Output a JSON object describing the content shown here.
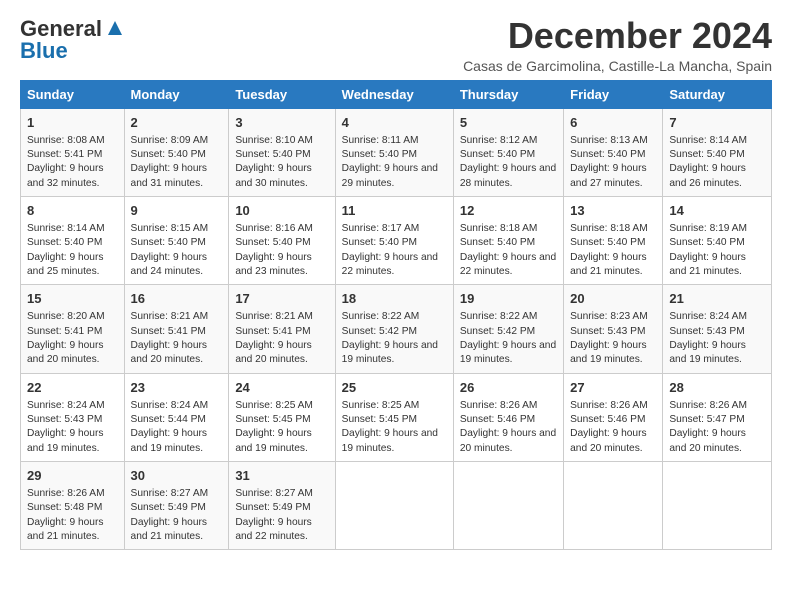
{
  "logo": {
    "line1": "General",
    "line2": "Blue"
  },
  "title": "December 2024",
  "subtitle": "Casas de Garcimolina, Castille-La Mancha, Spain",
  "days_of_week": [
    "Sunday",
    "Monday",
    "Tuesday",
    "Wednesday",
    "Thursday",
    "Friday",
    "Saturday"
  ],
  "weeks": [
    [
      {
        "day": "1",
        "sunrise": "8:08 AM",
        "sunset": "5:41 PM",
        "daylight": "9 hours and 32 minutes."
      },
      {
        "day": "2",
        "sunrise": "8:09 AM",
        "sunset": "5:40 PM",
        "daylight": "9 hours and 31 minutes."
      },
      {
        "day": "3",
        "sunrise": "8:10 AM",
        "sunset": "5:40 PM",
        "daylight": "9 hours and 30 minutes."
      },
      {
        "day": "4",
        "sunrise": "8:11 AM",
        "sunset": "5:40 PM",
        "daylight": "9 hours and 29 minutes."
      },
      {
        "day": "5",
        "sunrise": "8:12 AM",
        "sunset": "5:40 PM",
        "daylight": "9 hours and 28 minutes."
      },
      {
        "day": "6",
        "sunrise": "8:13 AM",
        "sunset": "5:40 PM",
        "daylight": "9 hours and 27 minutes."
      },
      {
        "day": "7",
        "sunrise": "8:14 AM",
        "sunset": "5:40 PM",
        "daylight": "9 hours and 26 minutes."
      }
    ],
    [
      {
        "day": "8",
        "sunrise": "8:14 AM",
        "sunset": "5:40 PM",
        "daylight": "9 hours and 25 minutes."
      },
      {
        "day": "9",
        "sunrise": "8:15 AM",
        "sunset": "5:40 PM",
        "daylight": "9 hours and 24 minutes."
      },
      {
        "day": "10",
        "sunrise": "8:16 AM",
        "sunset": "5:40 PM",
        "daylight": "9 hours and 23 minutes."
      },
      {
        "day": "11",
        "sunrise": "8:17 AM",
        "sunset": "5:40 PM",
        "daylight": "9 hours and 22 minutes."
      },
      {
        "day": "12",
        "sunrise": "8:18 AM",
        "sunset": "5:40 PM",
        "daylight": "9 hours and 22 minutes."
      },
      {
        "day": "13",
        "sunrise": "8:18 AM",
        "sunset": "5:40 PM",
        "daylight": "9 hours and 21 minutes."
      },
      {
        "day": "14",
        "sunrise": "8:19 AM",
        "sunset": "5:40 PM",
        "daylight": "9 hours and 21 minutes."
      }
    ],
    [
      {
        "day": "15",
        "sunrise": "8:20 AM",
        "sunset": "5:41 PM",
        "daylight": "9 hours and 20 minutes."
      },
      {
        "day": "16",
        "sunrise": "8:21 AM",
        "sunset": "5:41 PM",
        "daylight": "9 hours and 20 minutes."
      },
      {
        "day": "17",
        "sunrise": "8:21 AM",
        "sunset": "5:41 PM",
        "daylight": "9 hours and 20 minutes."
      },
      {
        "day": "18",
        "sunrise": "8:22 AM",
        "sunset": "5:42 PM",
        "daylight": "9 hours and 19 minutes."
      },
      {
        "day": "19",
        "sunrise": "8:22 AM",
        "sunset": "5:42 PM",
        "daylight": "9 hours and 19 minutes."
      },
      {
        "day": "20",
        "sunrise": "8:23 AM",
        "sunset": "5:43 PM",
        "daylight": "9 hours and 19 minutes."
      },
      {
        "day": "21",
        "sunrise": "8:24 AM",
        "sunset": "5:43 PM",
        "daylight": "9 hours and 19 minutes."
      }
    ],
    [
      {
        "day": "22",
        "sunrise": "8:24 AM",
        "sunset": "5:43 PM",
        "daylight": "9 hours and 19 minutes."
      },
      {
        "day": "23",
        "sunrise": "8:24 AM",
        "sunset": "5:44 PM",
        "daylight": "9 hours and 19 minutes."
      },
      {
        "day": "24",
        "sunrise": "8:25 AM",
        "sunset": "5:45 PM",
        "daylight": "9 hours and 19 minutes."
      },
      {
        "day": "25",
        "sunrise": "8:25 AM",
        "sunset": "5:45 PM",
        "daylight": "9 hours and 19 minutes."
      },
      {
        "day": "26",
        "sunrise": "8:26 AM",
        "sunset": "5:46 PM",
        "daylight": "9 hours and 20 minutes."
      },
      {
        "day": "27",
        "sunrise": "8:26 AM",
        "sunset": "5:46 PM",
        "daylight": "9 hours and 20 minutes."
      },
      {
        "day": "28",
        "sunrise": "8:26 AM",
        "sunset": "5:47 PM",
        "daylight": "9 hours and 20 minutes."
      }
    ],
    [
      {
        "day": "29",
        "sunrise": "8:26 AM",
        "sunset": "5:48 PM",
        "daylight": "9 hours and 21 minutes."
      },
      {
        "day": "30",
        "sunrise": "8:27 AM",
        "sunset": "5:49 PM",
        "daylight": "9 hours and 21 minutes."
      },
      {
        "day": "31",
        "sunrise": "8:27 AM",
        "sunset": "5:49 PM",
        "daylight": "9 hours and 22 minutes."
      },
      null,
      null,
      null,
      null
    ]
  ]
}
